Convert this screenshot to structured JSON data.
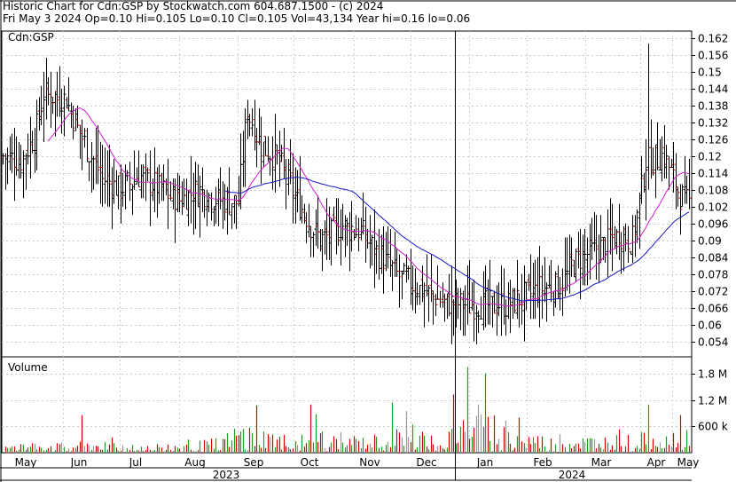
{
  "header": {
    "line1": "Historic Chart for Cdn:GSP by Stockwatch.com 604.687.1500 - (c) 2024",
    "line2": "Fri May  3 2024  Op=0.10  Hi=0.105  Lo=0.10  Cl=0.105  Vol=43,134  Year hi=0.16  lo=0.06"
  },
  "chart_data": {
    "type": "ohlc",
    "symbol_label": "Cdn:GSP",
    "price_axis": {
      "ticks": [
        "0.162",
        "0.156",
        "0.15",
        "0.144",
        "0.138",
        "0.132",
        "0.126",
        "0.12",
        "0.114",
        "0.108",
        "0.102",
        "0.096",
        "0.09",
        "0.084",
        "0.078",
        "0.072",
        "0.066",
        "0.06",
        "0.054"
      ],
      "range": [
        0.0485,
        0.1645
      ]
    },
    "volume_axis": {
      "title": "Volume",
      "ticks": [
        "1.8 M",
        "1.2 M",
        "600 k"
      ],
      "tick_values": [
        1800000,
        1200000,
        600000
      ],
      "range": [
        0,
        2150000
      ]
    },
    "months": [
      "May",
      "Jun",
      "Jul",
      "Aug",
      "Sep",
      "Oct",
      "Nov",
      "Dec",
      "Jan",
      "Feb",
      "Mar",
      "Apr",
      "May"
    ],
    "years": [
      "2023",
      "2024"
    ],
    "moving_average_colors": {
      "short": "#d020d0",
      "long": "#1818c8"
    },
    "up_color": "#000000",
    "down_color": "#d00000",
    "price_keypoints": [
      [
        0,
        0.12
      ],
      [
        8,
        0.118
      ],
      [
        14,
        0.127
      ],
      [
        18,
        0.142
      ],
      [
        28,
        0.14
      ],
      [
        34,
        0.128
      ],
      [
        44,
        0.112
      ],
      [
        52,
        0.108
      ],
      [
        60,
        0.113
      ],
      [
        68,
        0.109
      ],
      [
        78,
        0.104
      ],
      [
        86,
        0.108
      ],
      [
        96,
        0.104
      ],
      [
        104,
        0.104
      ],
      [
        108,
        0.136
      ],
      [
        114,
        0.124
      ],
      [
        122,
        0.118
      ],
      [
        130,
        0.104
      ],
      [
        140,
        0.09
      ],
      [
        150,
        0.095
      ],
      [
        158,
        0.093
      ],
      [
        166,
        0.085
      ],
      [
        174,
        0.078
      ],
      [
        184,
        0.073
      ],
      [
        194,
        0.068
      ],
      [
        204,
        0.067
      ],
      [
        214,
        0.067
      ],
      [
        222,
        0.067
      ],
      [
        230,
        0.07
      ],
      [
        238,
        0.073
      ],
      [
        246,
        0.074
      ],
      [
        252,
        0.082
      ],
      [
        262,
        0.087
      ],
      [
        272,
        0.092
      ],
      [
        278,
        0.09
      ],
      [
        284,
        0.118
      ],
      [
        292,
        0.12
      ],
      [
        299,
        0.106
      ],
      [
        303,
        0.103
      ]
    ],
    "volume_profile": [
      [
        0,
        180000
      ],
      [
        20,
        140000
      ],
      [
        40,
        160000
      ],
      [
        60,
        140000
      ],
      [
        80,
        130000
      ],
      [
        95,
        220000
      ],
      [
        105,
        420000
      ],
      [
        125,
        260000
      ],
      [
        140,
        330000
      ],
      [
        160,
        230000
      ],
      [
        178,
        380000
      ],
      [
        195,
        280000
      ],
      [
        205,
        640000
      ],
      [
        215,
        500000
      ],
      [
        228,
        330000
      ],
      [
        245,
        200000
      ],
      [
        262,
        250000
      ],
      [
        278,
        260000
      ],
      [
        288,
        320000
      ],
      [
        303,
        250000
      ]
    ],
    "volume_spikes": [
      [
        35,
        860000
      ],
      [
        48,
        350000
      ],
      [
        82,
        300000
      ],
      [
        101,
        280000
      ],
      [
        112,
        1080000
      ],
      [
        136,
        1100000
      ],
      [
        138,
        880000
      ],
      [
        172,
        1150000
      ],
      [
        178,
        950000
      ],
      [
        181,
        640000
      ],
      [
        199,
        1330000
      ],
      [
        205,
        1960000
      ],
      [
        210,
        1100000
      ],
      [
        213,
        1810000
      ],
      [
        217,
        850000
      ],
      [
        222,
        730000
      ],
      [
        228,
        800000
      ],
      [
        246,
        420000
      ],
      [
        272,
        530000
      ],
      [
        285,
        1100000
      ],
      [
        299,
        860000
      ],
      [
        302,
        520000
      ]
    ],
    "total_bars": 304
  }
}
